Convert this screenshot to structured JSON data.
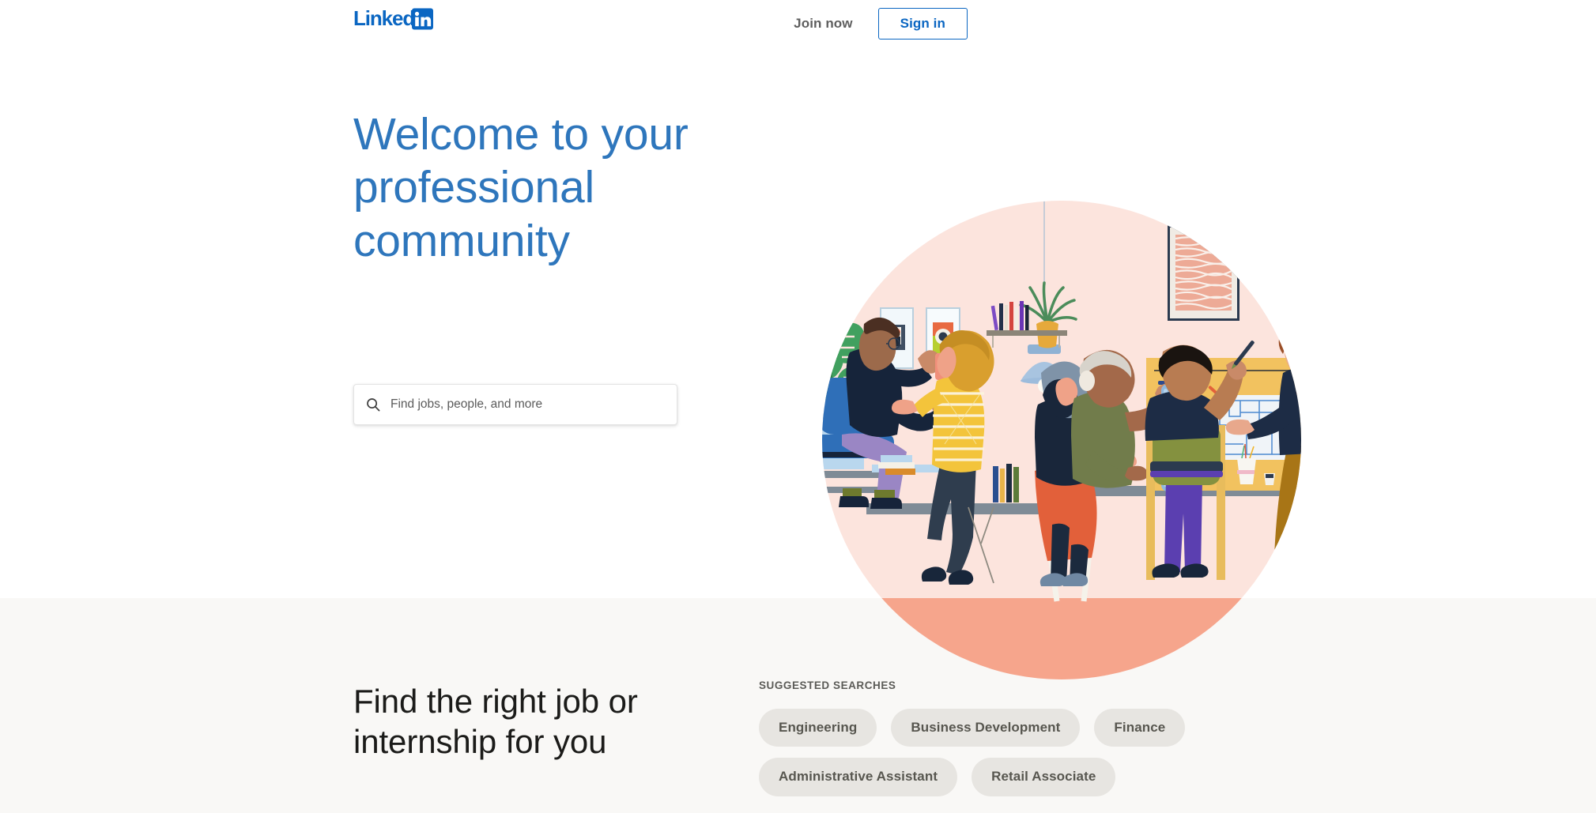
{
  "header": {
    "logo_text": "Linked",
    "logo_mark": "in",
    "logo_icon": "linkedin-logo",
    "join_now_label": "Join now",
    "sign_in_label": "Sign in"
  },
  "hero": {
    "heading": "Welcome to your professional community",
    "heading_color": "#2e76bc"
  },
  "search": {
    "icon": "search-icon",
    "placeholder": "Find jobs, people, and more",
    "value": ""
  },
  "illustration": {
    "name": "office-collaboration-illustration",
    "circle_color": "#fce4dd",
    "circle_lower_color": "#f6a58c",
    "wall_art_left": "framed-photo-dark",
    "wall_art_right": "framed-photo-green",
    "wall_art_large": "framed-wave-art",
    "lamp": "pendant-lamp",
    "plant_shelf": "bookshelf-with-plant",
    "floor_plant": "monstera-plant",
    "board": "yellow-whiteboard-with-blueprint"
  },
  "bottom": {
    "heading": "Find the right job or internship for you",
    "suggested_label": "SUGGESTED SEARCHES",
    "chips": [
      "Engineering",
      "Business Development",
      "Finance",
      "Administrative Assistant",
      "Retail Associate"
    ]
  },
  "colors": {
    "brand_blue": "#0a66c2",
    "heading_blue": "#2e76bc",
    "band_cream": "#f9f8f6",
    "chip_bg": "#e7e5e1",
    "chip_text": "#57564f"
  }
}
